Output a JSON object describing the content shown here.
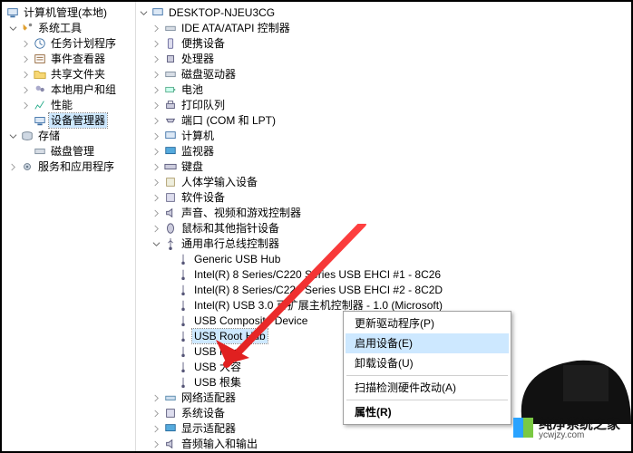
{
  "left_root": "计算机管理(本地)",
  "left": {
    "sys_tools": "系统工具",
    "task_sched": "任务计划程序",
    "event_viewer": "事件查看器",
    "shared": "共享文件夹",
    "users": "本地用户和组",
    "perf": "性能",
    "devmgr": "设备管理器",
    "storage": "存储",
    "disk": "磁盘管理",
    "services": "服务和应用程序"
  },
  "right_root": "DESKTOP-NJEU3CG",
  "devcat": {
    "ide": "IDE ATA/ATAPI 控制器",
    "portable": "便携设备",
    "cpu": "处理器",
    "disk": "磁盘驱动器",
    "battery": "电池",
    "printq": "打印队列",
    "ports": "端口 (COM 和 LPT)",
    "computer": "计算机",
    "monitor": "监视器",
    "keyboard": "键盘",
    "hid": "人体学输入设备",
    "software": "软件设备",
    "sound": "声音、视频和游戏控制器",
    "mouse": "鼠标和其他指针设备",
    "usb": "通用串行总线控制器",
    "usb_items": {
      "generic": "Generic USB Hub",
      "ehci1": "Intel(R) 8 Series/C220 Series USB EHCI #1 - 8C26",
      "ehci2": "Intel(R) 8 Series/C220 Series USB EHCI #2 - 8C2D",
      "xhci": "Intel(R) USB 3.0 可扩展主机控制器 - 1.0 (Microsoft)",
      "composite": "USB Composite Device",
      "root_hub_sel": "USB Root Hub",
      "root_hub2": "USB Root",
      "mass": "USB 大容",
      "root_hub3": "USB 根集"
    },
    "net": "网络适配器",
    "sysdev": "系统设备",
    "display": "显示适配器",
    "audio": "音频输入和输出"
  },
  "menu": {
    "update": "更新驱动程序(P)",
    "enable": "启用设备(E)",
    "uninstall": "卸载设备(U)",
    "scan": "扫描检测硬件改动(A)",
    "props": "属性(R)"
  },
  "watermark": {
    "brand": "纯净系统之家",
    "url": "ycwjzy.com"
  }
}
